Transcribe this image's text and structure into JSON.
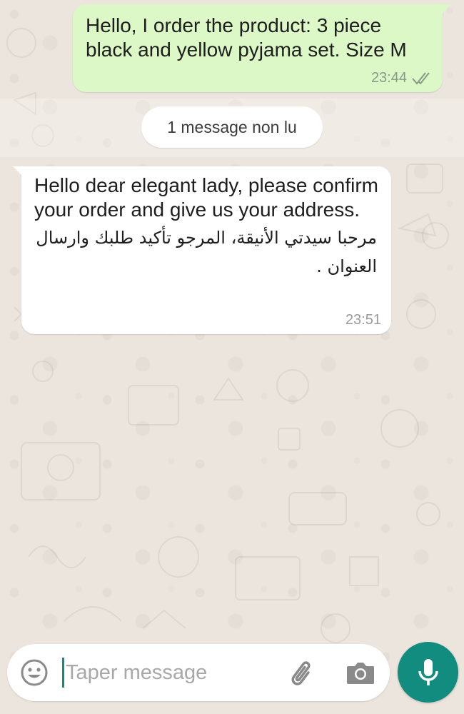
{
  "chat": {
    "outgoing": {
      "text": "Hello, I order the product: 3 piece black and yellow pyjama set. Size M",
      "time": "23:44",
      "status_icon": "double-check-icon"
    },
    "unread_banner": "1 message non lu",
    "incoming": {
      "text_en": "Hello dear elegant lady, please confirm your order and give us your address.",
      "text_ar": "مرحبا سيدتي الأنيقة، المرجو تأكيد طلبك وارسال العنوان .",
      "time": "23:51"
    }
  },
  "composer": {
    "placeholder": "Taper message",
    "value": "",
    "icons": {
      "emoji": "emoji-icon",
      "attach": "paperclip-icon",
      "camera": "camera-icon",
      "mic": "microphone-icon"
    }
  },
  "colors": {
    "outgoing_bubble": "#dcf8c6",
    "incoming_bubble": "#ffffff",
    "wallpaper": "#ece5dd",
    "accent": "#128c7e",
    "ticks": "#8a9a88"
  }
}
